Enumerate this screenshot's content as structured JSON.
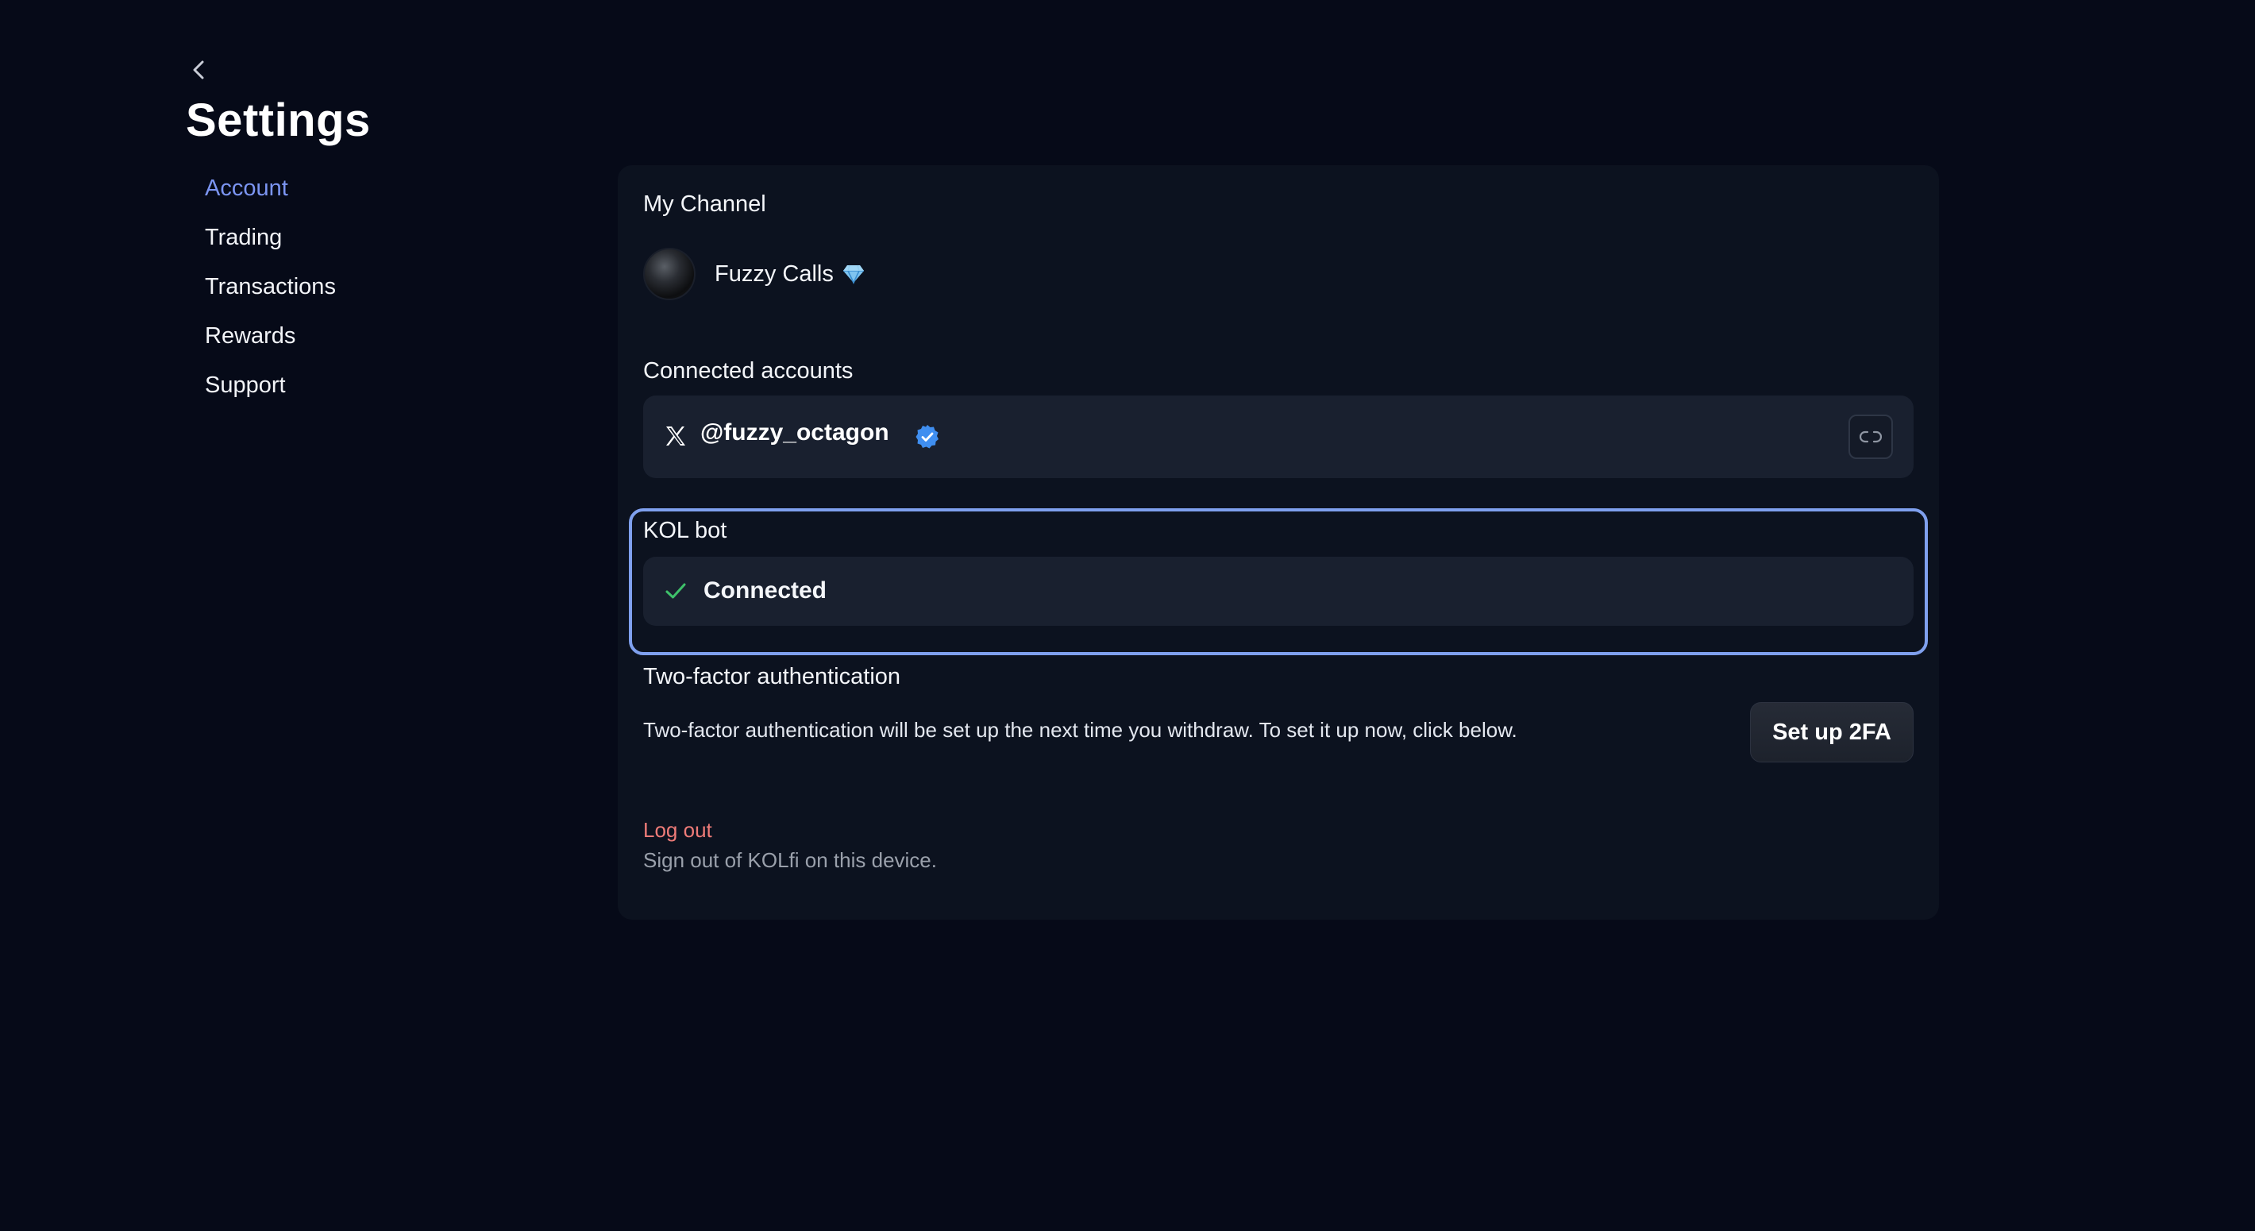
{
  "page": {
    "title": "Settings"
  },
  "sidebar": {
    "items": [
      {
        "label": "Account",
        "active": true
      },
      {
        "label": "Trading"
      },
      {
        "label": "Transactions"
      },
      {
        "label": "Rewards"
      },
      {
        "label": "Support"
      }
    ]
  },
  "channel": {
    "section_label": "My Channel",
    "name": "Fuzzy Calls",
    "badge_icon": "gem-icon"
  },
  "connected_accounts": {
    "section_label": "Connected accounts",
    "x_handle": "@fuzzy_octagon",
    "verified": true
  },
  "kol_bot": {
    "section_label": "KOL bot",
    "status": "Connected"
  },
  "two_factor": {
    "section_label": "Two-factor authentication",
    "description": "Two-factor authentication will be set up the next time you withdraw. To set it up now, click below.",
    "button_label": "Set up 2FA"
  },
  "logout": {
    "label": "Log out",
    "description": "Sign out of KOLfi on this device."
  },
  "colors": {
    "background": "#060a18",
    "card": "#0c121f",
    "accent": "#7b95f2",
    "danger": "#ee7b78",
    "success": "#3ec16a",
    "highlight": "#7fa0ee"
  }
}
